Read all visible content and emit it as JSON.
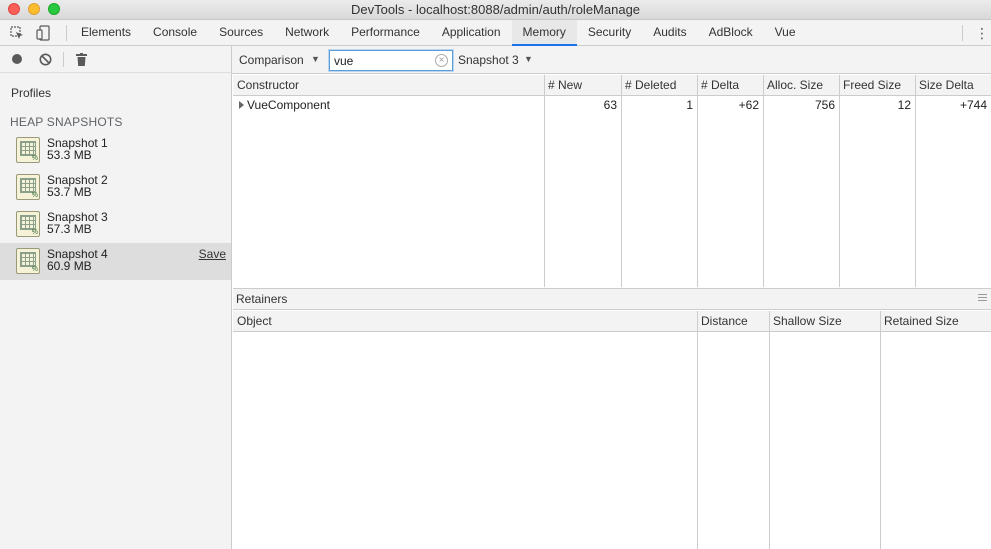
{
  "window": {
    "title": "DevTools - localhost:8088/admin/auth/roleManage"
  },
  "tabs": [
    "Elements",
    "Console",
    "Sources",
    "Network",
    "Performance",
    "Application",
    "Memory",
    "Security",
    "Audits",
    "AdBlock",
    "Vue"
  ],
  "active_tab": "Memory",
  "sidebar": {
    "profiles_label": "Profiles",
    "section_label": "HEAP SNAPSHOTS",
    "snapshots": [
      {
        "name": "Snapshot 1",
        "size": "53.3 MB"
      },
      {
        "name": "Snapshot 2",
        "size": "53.7 MB"
      },
      {
        "name": "Snapshot 3",
        "size": "57.3 MB"
      },
      {
        "name": "Snapshot 4",
        "size": "60.9 MB",
        "action": "Save"
      }
    ],
    "selected": "Snapshot 4"
  },
  "toolbar": {
    "view_mode": "Comparison",
    "filter_value": "vue",
    "compare_with": "Snapshot 3"
  },
  "constructors": {
    "headers": [
      "Constructor",
      "# New",
      "# Deleted",
      "# Delta",
      "Alloc. Size",
      "Freed Size",
      "Size Delta"
    ],
    "rows": [
      {
        "constructor": "VueComponent",
        "new": "63",
        "deleted": "1",
        "delta": "+62",
        "alloc_size": "756",
        "freed_size": "12",
        "size_delta": "+744"
      }
    ]
  },
  "retainers": {
    "title": "Retainers",
    "headers": [
      "Object",
      "Distance",
      "Shallow Size",
      "Retained Size"
    ]
  },
  "colors": {
    "accent": "#1a73e8",
    "panel_bg": "#f3f3f3",
    "selected_bg": "#dddddd"
  }
}
